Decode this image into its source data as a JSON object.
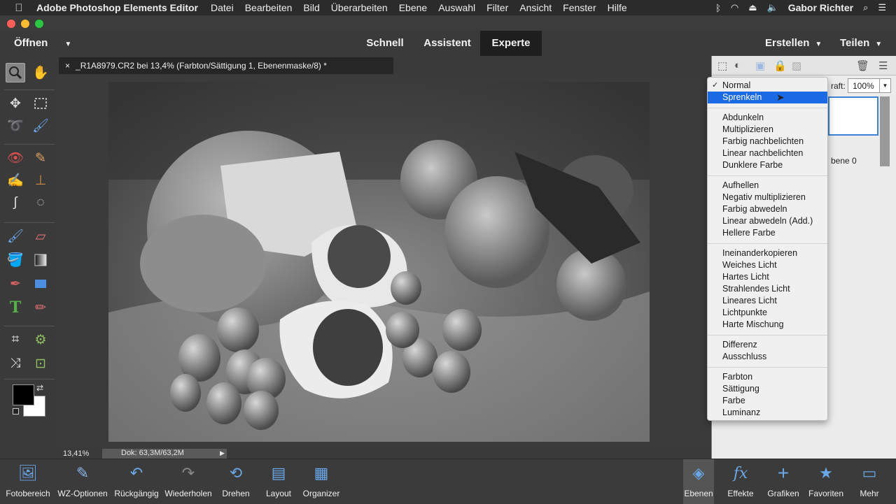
{
  "menubar": {
    "app_name": "Adobe Photoshop Elements Editor",
    "menus": [
      "Datei",
      "Bearbeiten",
      "Bild",
      "Überarbeiten",
      "Ebene",
      "Auswahl",
      "Filter",
      "Ansicht",
      "Fenster",
      "Hilfe"
    ],
    "user": "Gabor Richter"
  },
  "modebar": {
    "open_label": "Öffnen",
    "modes": [
      "Schnell",
      "Assistent",
      "Experte"
    ],
    "active_mode": "Experte",
    "create_label": "Erstellen",
    "share_label": "Teilen"
  },
  "document": {
    "tab_title": "_R1A8979.CR2 bei 13,4% (Farbton/Sättigung 1, Ebenenmaske/8) *",
    "close_symbol": "×"
  },
  "status": {
    "zoom": "13,41%",
    "doc_size": "Dok: 63,3M/63,2M"
  },
  "layers_panel": {
    "opacity_label": "raft:",
    "opacity_value": "100%",
    "layer_name_partial": "bene 0"
  },
  "blend_menu": {
    "checked": "Normal",
    "highlighted": "Sprenkeln",
    "groups": [
      [
        "Normal",
        "Sprenkeln"
      ],
      [
        "Abdunkeln",
        "Multiplizieren",
        "Farbig nachbelichten",
        "Linear nachbelichten",
        "Dunklere Farbe"
      ],
      [
        "Aufhellen",
        "Negativ multiplizieren",
        "Farbig abwedeln",
        "Linear abwedeln (Add.)",
        "Hellere Farbe"
      ],
      [
        "Ineinanderkopieren",
        "Weiches Licht",
        "Hartes Licht",
        "Strahlendes Licht",
        "Lineares Licht",
        "Lichtpunkte",
        "Harte Mischung"
      ],
      [
        "Differenz",
        "Ausschluss"
      ],
      [
        "Farbton",
        "Sättigung",
        "Farbe",
        "Luminanz"
      ]
    ]
  },
  "bottombar": {
    "left": [
      "Fotobereich",
      "WZ-Optionen",
      "Rückgängig",
      "Wiederholen",
      "Drehen",
      "Layout",
      "Organizer"
    ],
    "right": [
      "Ebenen",
      "Effekte",
      "Grafiken",
      "Favoriten",
      "Mehr"
    ],
    "active": "Ebenen"
  },
  "colors": {
    "accent": "#1a6ae6",
    "foreground_swatch": "#000000",
    "background_swatch": "#ffffff"
  }
}
